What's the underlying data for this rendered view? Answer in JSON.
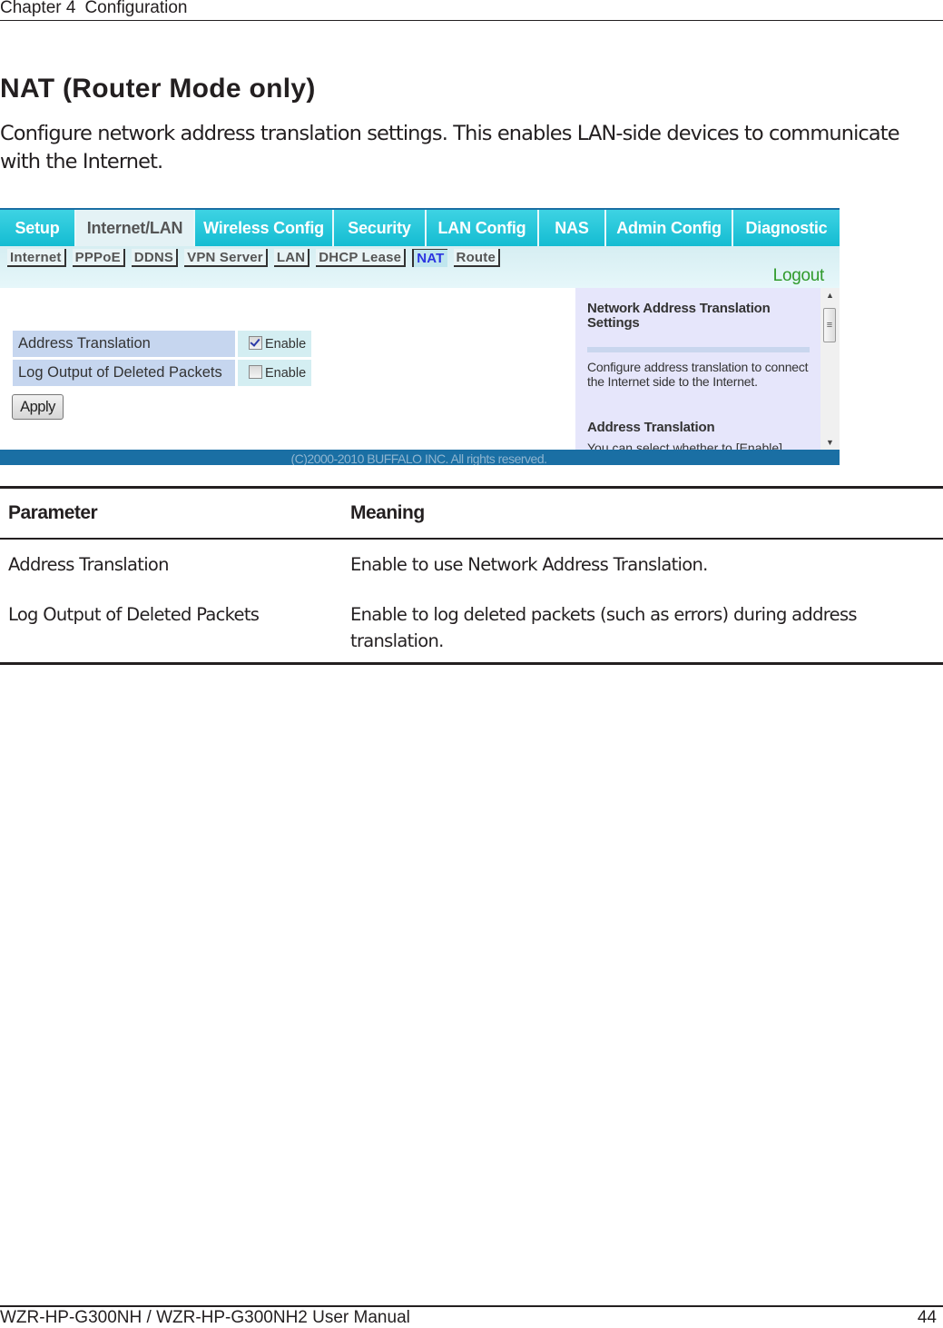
{
  "header": {
    "chapter": "Chapter 4",
    "section": "Configuration"
  },
  "page": {
    "title": "NAT (Router Mode only)",
    "intro": "Configure network address translation settings. This enables LAN-side devices to communicate with the Internet."
  },
  "router_ui": {
    "colors": {
      "tab_bg": "#1fc3d6",
      "active_tab_bg": "#e4f2f5",
      "subnav_bg": "#d6eef2",
      "active_subtab_text": "#2b34e0",
      "logout_text": "#2f9a2b",
      "help_bg": "#e6e6fb",
      "footer_bg": "#1a6fa4"
    },
    "tabs": [
      {
        "label": "Setup",
        "active": false
      },
      {
        "label": "Internet/LAN",
        "active": true
      },
      {
        "label": "Wireless Config",
        "active": false
      },
      {
        "label": "Security",
        "active": false
      },
      {
        "label": "LAN Config",
        "active": false
      },
      {
        "label": "NAS",
        "active": false
      },
      {
        "label": "Admin Config",
        "active": false
      },
      {
        "label": "Diagnostic",
        "active": false
      }
    ],
    "subtabs": [
      {
        "label": "Internet",
        "active": false
      },
      {
        "label": "PPPoE",
        "active": false
      },
      {
        "label": "DDNS",
        "active": false
      },
      {
        "label": "VPN Server",
        "active": false
      },
      {
        "label": "LAN",
        "active": false
      },
      {
        "label": "DHCP Lease",
        "active": false
      },
      {
        "label": "NAT",
        "active": true
      },
      {
        "label": "Route",
        "active": false
      }
    ],
    "logout_label": "Logout",
    "settings": [
      {
        "label": "Address Translation",
        "option": "Enable",
        "checked": true
      },
      {
        "label": "Log Output of Deleted Packets",
        "option": "Enable",
        "checked": false
      }
    ],
    "apply_label": "Apply",
    "help": {
      "title": "Network Address Translation Settings",
      "text": "Configure address translation to connect the Internet side to the Internet.",
      "subtitle": "Address Translation",
      "cut_text": "You can select whether to [Enable]"
    },
    "scrollbar": {
      "up_icon": "▲",
      "down_icon": "▼",
      "grip_icon": "≡"
    },
    "footer": "(C)2000-2010 BUFFALO INC. All rights reserved."
  },
  "params_table": {
    "headers": [
      "Parameter",
      "Meaning"
    ],
    "rows": [
      {
        "parameter": "Address Translation",
        "meaning": "Enable to use Network Address Translation."
      },
      {
        "parameter": "Log Output of Deleted Packets",
        "meaning": "Enable to log deleted packets (such as errors) during address translation."
      }
    ]
  },
  "footer": {
    "manual": "WZR-HP-G300NH / WZR-HP-G300NH2 User Manual",
    "page_number": "44"
  }
}
